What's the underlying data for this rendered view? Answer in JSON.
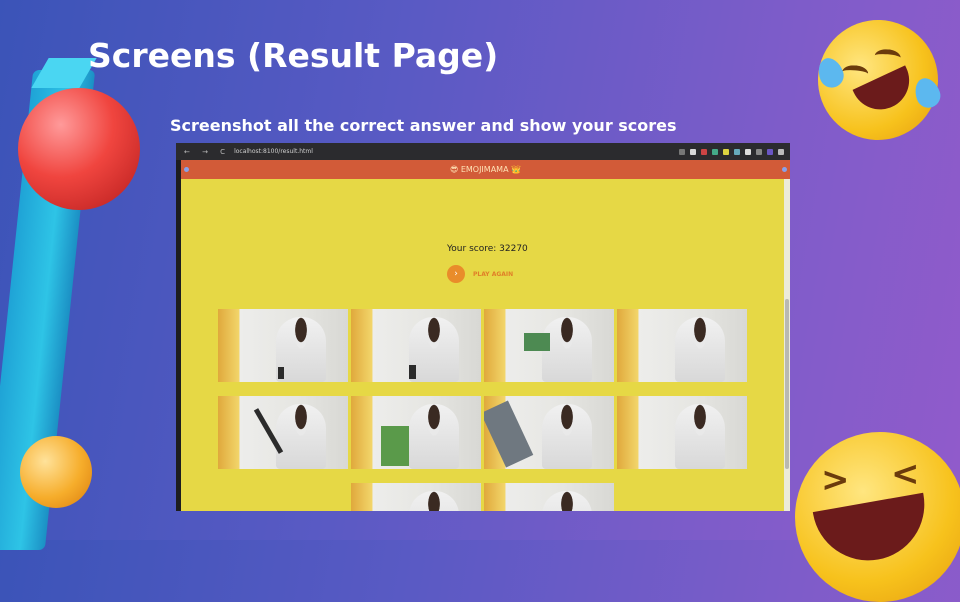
{
  "slide": {
    "title": "Screens (Result Page)",
    "subtitle": "Screenshot all the correct answer and show your scores"
  },
  "browser": {
    "url": "localhost:8100/result.html",
    "nav_glyphs": "← → C"
  },
  "app": {
    "title": "😎 EMOJIMAMA 👑",
    "score_text": "Your score: 32270",
    "play_again_label": "PLAY AGAIN",
    "play_icon": "›"
  },
  "results": {
    "thumbnails": [
      {
        "object": "pen"
      },
      {
        "object": "phone"
      },
      {
        "object": "card"
      },
      {
        "object": "none"
      },
      {
        "object": "marker"
      },
      {
        "object": "book"
      },
      {
        "object": "bottle"
      },
      {
        "object": "none"
      },
      {
        "object": "none"
      },
      {
        "object": "none"
      }
    ]
  },
  "colors": {
    "app_bar": "#d25b38",
    "content_bg": "#e6d845",
    "accent": "#e98c2a"
  }
}
